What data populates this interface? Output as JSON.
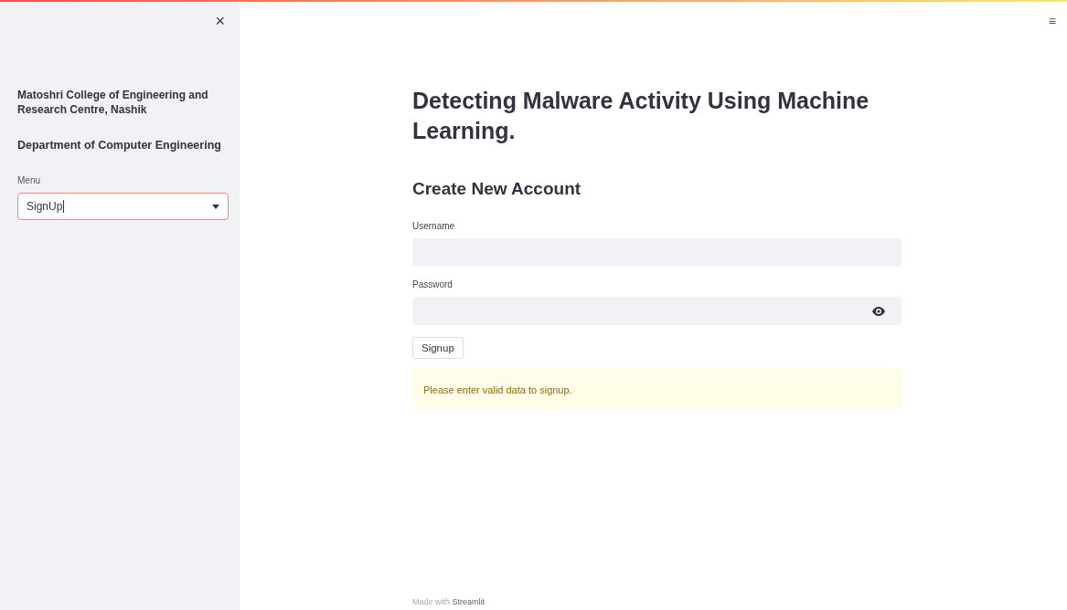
{
  "sidebar": {
    "close": "×",
    "college": "Matoshri College of Engineering and Research Centre, Nashik",
    "department": "Department of Computer Engineering",
    "menu": {
      "label": "Menu",
      "value": "SignUp",
      "focused": true
    }
  },
  "menu_button": "≡",
  "main": {
    "title": "Detecting Malware Activity Using Machine Learning.",
    "subtitle": "Create New Account",
    "fields": [
      {
        "label": "Username",
        "kind": "text"
      },
      {
        "label": "Password",
        "kind": "password"
      }
    ],
    "button": "Signup",
    "alert": {
      "kind": "warning",
      "text": "Please enter valid data to signup."
    }
  },
  "footer": "Made with **Streamlit**"
}
